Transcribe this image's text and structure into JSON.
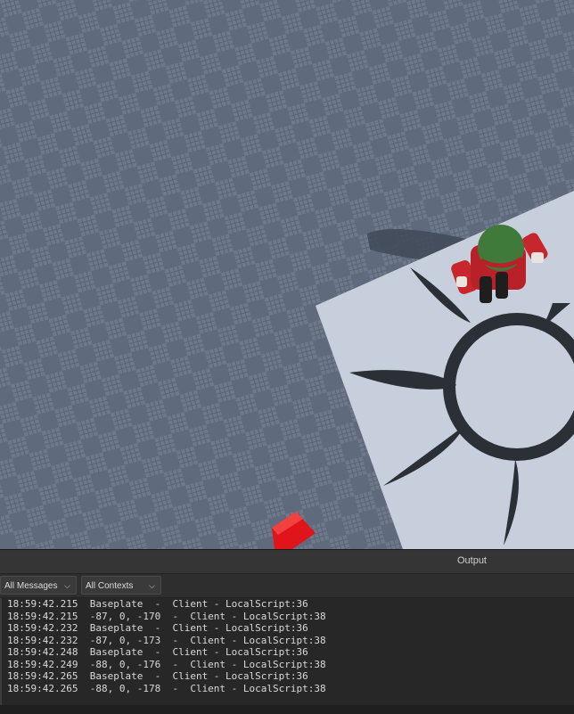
{
  "output": {
    "title": "Output",
    "filters": {
      "messages": "All Messages",
      "contexts": "All Contexts"
    },
    "lines": [
      {
        "time": "18:59:42.215",
        "message": "Baseplate  -  Client - LocalScript:36"
      },
      {
        "time": "18:59:42.215",
        "message": "-87, 0, -170  -  Client - LocalScript:38"
      },
      {
        "time": "18:59:42.232",
        "message": "Baseplate  -  Client - LocalScript:36"
      },
      {
        "time": "18:59:42.232",
        "message": "-87, 0, -173  -  Client - LocalScript:38"
      },
      {
        "time": "18:59:42.248",
        "message": "Baseplate  -  Client - LocalScript:36"
      },
      {
        "time": "18:59:42.249",
        "message": "-88, 0, -176  -  Client - LocalScript:38"
      },
      {
        "time": "18:59:42.265",
        "message": "Baseplate  -  Client - LocalScript:36"
      },
      {
        "time": "18:59:42.265",
        "message": "-88, 0, -178  -  Client - LocalScript:38"
      }
    ]
  },
  "colors": {
    "baseplate": "#5f6b7c",
    "baseplate_tile": "#6c7889",
    "grid_line": "#4f5a69",
    "platform": "#c9d0dd",
    "emblem": "#2b2f36",
    "red_block": "#e0141b",
    "character_head": "#3f7a3a",
    "character_body": "#c8262d"
  },
  "icons": {
    "dropdown": "chevron-down-icon"
  }
}
